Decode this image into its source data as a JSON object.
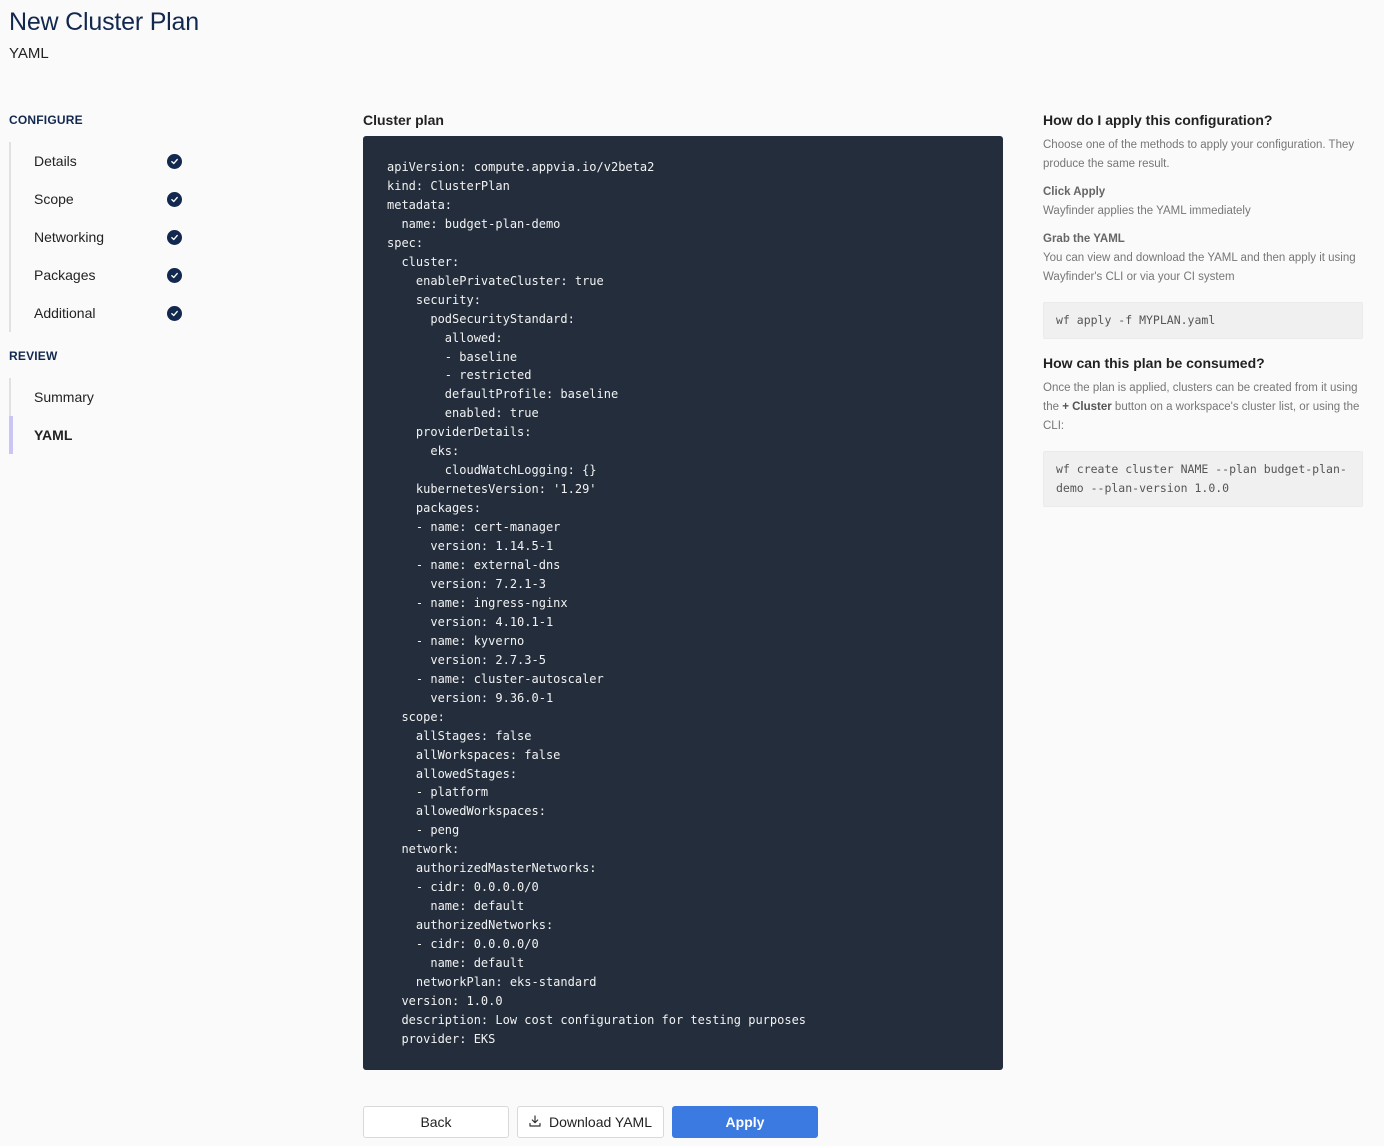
{
  "header": {
    "title": "New Cluster Plan",
    "subtitle": "YAML"
  },
  "sidebar": {
    "sections": [
      {
        "label": "CONFIGURE",
        "items": [
          {
            "label": "Details",
            "completed": true
          },
          {
            "label": "Scope",
            "completed": true
          },
          {
            "label": "Networking",
            "completed": true
          },
          {
            "label": "Packages",
            "completed": true
          },
          {
            "label": "Additional",
            "completed": true
          }
        ]
      },
      {
        "label": "REVIEW",
        "items": [
          {
            "label": "Summary",
            "completed": false
          },
          {
            "label": "YAML",
            "completed": false,
            "active": true
          }
        ]
      }
    ],
    "icons": {
      "completed": "check-circle-icon"
    }
  },
  "main": {
    "label": "Cluster plan",
    "yaml": "apiVersion: compute.appvia.io/v2beta2\nkind: ClusterPlan\nmetadata:\n  name: budget-plan-demo\nspec:\n  cluster:\n    enablePrivateCluster: true\n    security:\n      podSecurityStandard:\n        allowed:\n        - baseline\n        - restricted\n        defaultProfile: baseline\n        enabled: true\n    providerDetails:\n      eks:\n        cloudWatchLogging: {}\n    kubernetesVersion: '1.29'\n    packages:\n    - name: cert-manager\n      version: 1.14.5-1\n    - name: external-dns\n      version: 7.2.1-3\n    - name: ingress-nginx\n      version: 4.10.1-1\n    - name: kyverno\n      version: 2.7.3-5\n    - name: cluster-autoscaler\n      version: 9.36.0-1\n  scope:\n    allStages: false\n    allWorkspaces: false\n    allowedStages:\n    - platform\n    allowedWorkspaces:\n    - peng\n  network:\n    authorizedMasterNetworks:\n    - cidr: 0.0.0.0/0\n      name: default\n    authorizedNetworks:\n    - cidr: 0.0.0.0/0\n      name: default\n    networkPlan: eks-standard\n  version: 1.0.0\n  description: Low cost configuration for testing purposes\n  provider: EKS"
  },
  "actions": {
    "back_label": "Back",
    "download_label": "Download YAML",
    "download_icon": "download-icon",
    "apply_label": "Apply",
    "apply_color": "#3b7ae0"
  },
  "help": {
    "apply_heading": "How do I apply this configuration?",
    "apply_intro": "Choose one of the methods to apply your configuration. They produce the same result.",
    "method1_title": "Click Apply",
    "method1_text": "Wayfinder applies the YAML immediately",
    "method2_title": "Grab the YAML",
    "method2_text": "You can view and download the YAML and then apply it using Wayfinder's CLI or via your CI system",
    "apply_command": "wf apply -f MYPLAN.yaml",
    "consume_heading": "How can this plan be consumed?",
    "consume_text_before": "Once the plan is applied, clusters can be created from it using the ",
    "consume_text_bold": "+ Cluster",
    "consume_text_after": " button on a workspace's cluster list, or using the CLI:",
    "consume_command": "wf create cluster NAME --plan budget-plan-demo --plan-version 1.0.0"
  },
  "colors": {
    "brand_navy": "#13284f",
    "code_bg": "#232d3b",
    "active_indicator": "#c9c6f5"
  }
}
